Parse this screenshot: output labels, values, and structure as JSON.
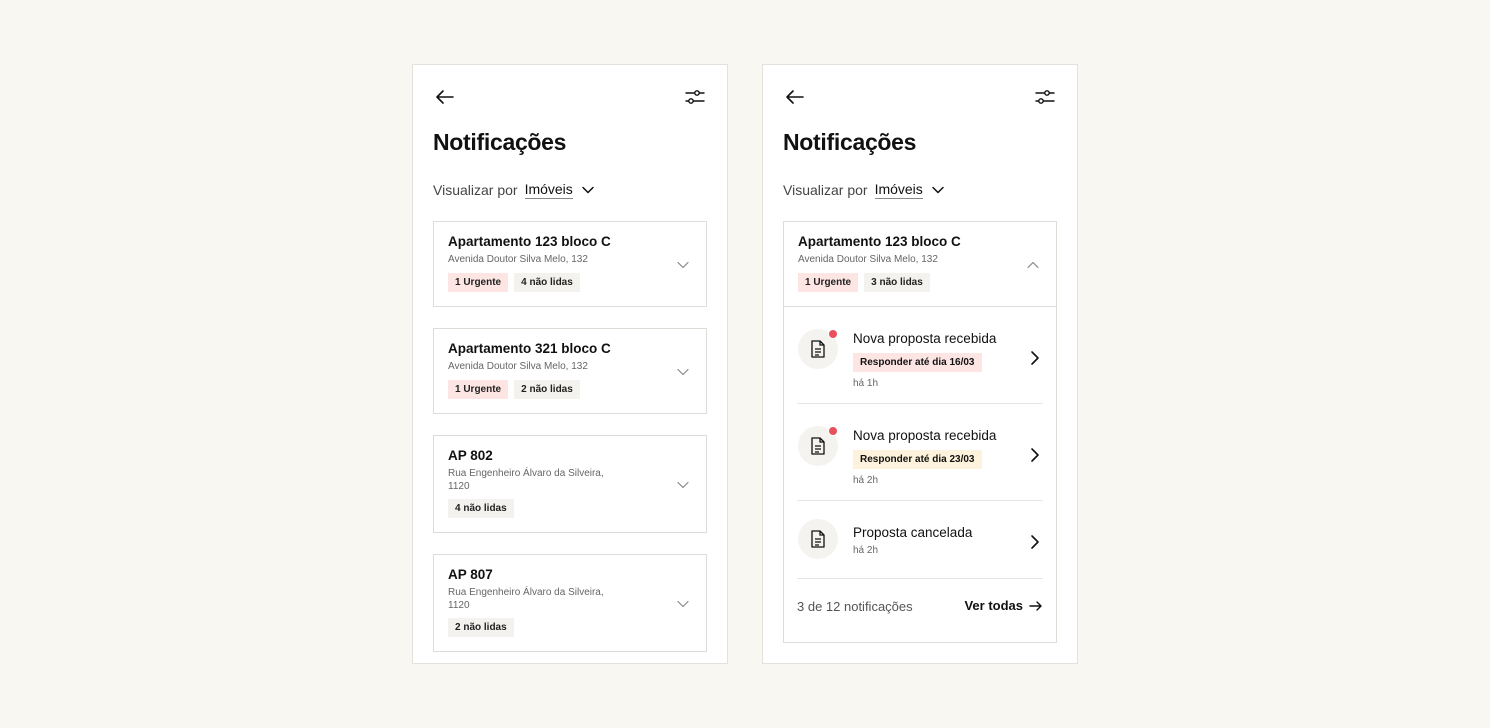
{
  "screens": [
    {
      "title": "Notificações",
      "view_by": {
        "label": "Visualizar por",
        "value": "Imóveis"
      },
      "properties": [
        {
          "name": "Apartamento 123 bloco C",
          "address": "Avenida Doutor Silva Melo, 132",
          "urgent": "1 Urgente",
          "unread": "4 não lidas"
        },
        {
          "name": "Apartamento 321 bloco C",
          "address": "Avenida Doutor Silva Melo, 132",
          "urgent": "1 Urgente",
          "unread": "2 não lidas"
        },
        {
          "name": "AP 802",
          "address": "Rua Engenheiro Álvaro da Silveira, 1120",
          "unread": "4 não lidas"
        },
        {
          "name": "AP 807",
          "address": "Rua Engenheiro Álvaro da Silveira, 1120",
          "unread": "2 não lidas"
        }
      ]
    },
    {
      "title": "Notificações",
      "view_by": {
        "label": "Visualizar por",
        "value": "Imóveis"
      },
      "property": {
        "name": "Apartamento 123 bloco C",
        "address": "Avenida Doutor Silva Melo, 132",
        "urgent": "1 Urgente",
        "unread": "3 não lidas"
      },
      "notifications": [
        {
          "title": "Nova proposta recebida",
          "deadline": "Responder até dia 16/03",
          "time": "há 1h"
        },
        {
          "title": "Nova proposta recebida",
          "deadline": "Responder até dia 23/03",
          "time": "há 2h"
        },
        {
          "title": "Proposta cancelada",
          "time": "há 2h"
        }
      ],
      "footer": {
        "count": "3 de 12 notificações",
        "link": "Ver todas"
      }
    }
  ],
  "colors": {
    "background": "#f8f7f2",
    "urgent_badge": "#fde5e4",
    "neutral_badge": "#f3f2ee",
    "deadline_warning": "#fdf2dc",
    "unread_dot": "#e8505b"
  },
  "icons": {
    "back": "arrow-left-icon",
    "filter": "sliders-icon",
    "expand": "chevron-down-icon",
    "collapse": "chevron-up-icon",
    "open": "chevron-right-icon",
    "document": "document-icon",
    "see_all": "arrow-right-icon"
  }
}
